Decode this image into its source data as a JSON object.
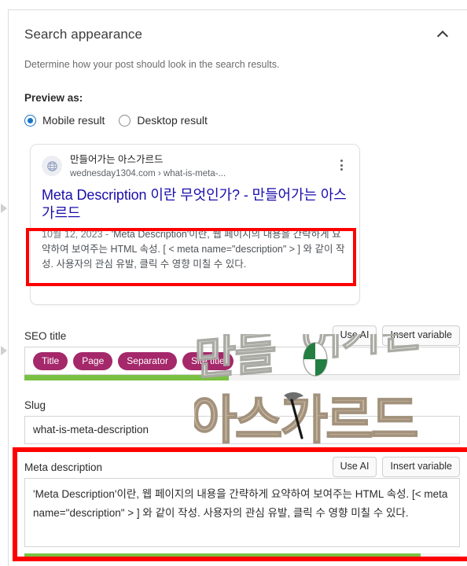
{
  "panel": {
    "title": "Search appearance",
    "description": "Determine how your post should look in the search results.",
    "collapse_icon": "chevron-up-icon"
  },
  "preview_as": {
    "label": "Preview as:",
    "options": [
      {
        "label": "Mobile result",
        "selected": true
      },
      {
        "label": "Desktop result",
        "selected": false
      }
    ]
  },
  "google_preview": {
    "favicon_icon": "globe-icon",
    "site_name": "만들어가는 아스가르드",
    "url": "wednesday1304.com › what-is-meta-...",
    "menu_icon": "more-vertical-icon",
    "title": "Meta Description 이란 무엇인가? - 만들어가는 아스가르드",
    "date": "10월 12, 2023",
    "date_separator": "-",
    "description": "'Meta Description'이란, 웹 페이지의 내용을 간략하게 요약하여 보여주는 HTML 속성. [ < meta name=\"description\" > ] 와 같이 작성. 사용자의 관심 유발, 클릭 수 영향 미칠 수 있다."
  },
  "seo_title": {
    "label": "SEO title",
    "use_ai_label": "Use AI",
    "insert_variable_label": "Insert variable",
    "variables": [
      "Title",
      "Page",
      "Separator",
      "Site title"
    ],
    "progress_percent": 47,
    "progress_color": "#7ac143"
  },
  "slug": {
    "label": "Slug",
    "value": "what-is-meta-description"
  },
  "meta_description": {
    "label": "Meta description",
    "use_ai_label": "Use AI",
    "insert_variable_label": "Insert variable",
    "value": "'Meta Description'이란, 웹 페이지의 내용을 간략하게 요약하여 보여주는 HTML 속성. [< meta name=\"description\" > ] 와 같이 작성. 사용자의 관심 유발, 클릭 수 영향 미칠 수 있다.",
    "progress_percent": 91,
    "progress_color": "#7ac143"
  },
  "annotations": {
    "highlight_color": "#fd0000",
    "boxes": [
      "google-preview-description",
      "meta-description-field"
    ]
  },
  "watermark": {
    "line1": "만들어가는",
    "line2": "아스가르드"
  },
  "theme": {
    "accent": "#a4286a",
    "link": "#1a0dab",
    "radio_selected": "#1a73c8",
    "progress_green": "#7ac143"
  }
}
